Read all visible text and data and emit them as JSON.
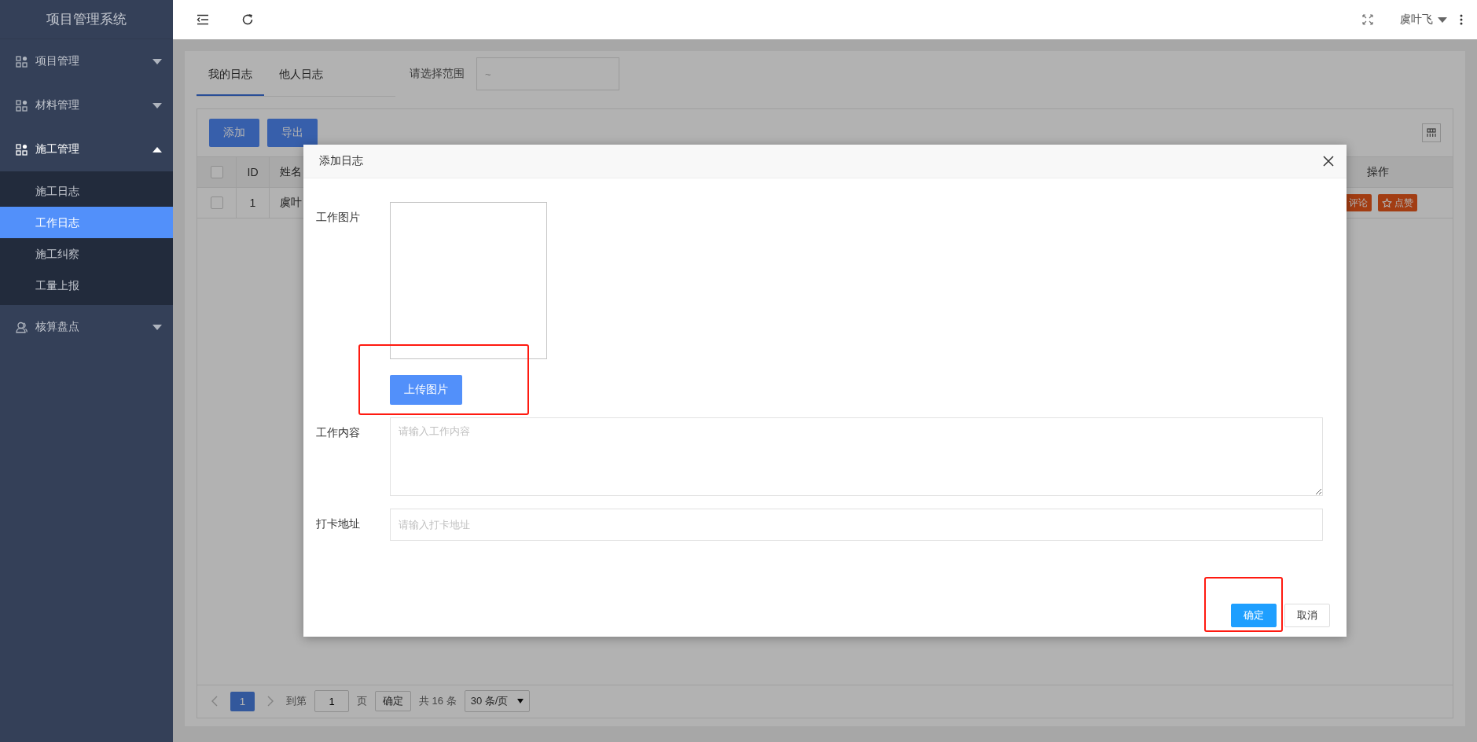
{
  "sidebar": {
    "title": "项目管理系统",
    "items": [
      {
        "label": "项目管理",
        "expanded": false
      },
      {
        "label": "材料管理",
        "expanded": false
      },
      {
        "label": "施工管理",
        "expanded": true,
        "children": [
          {
            "label": "施工日志",
            "selected": false
          },
          {
            "label": "工作日志",
            "selected": true
          },
          {
            "label": "施工纠察",
            "selected": false
          },
          {
            "label": "工量上报",
            "selected": false
          }
        ]
      },
      {
        "label": "核算盘点",
        "expanded": false
      }
    ]
  },
  "header": {
    "user": "虞叶飞"
  },
  "tabs": [
    {
      "label": "我的日志",
      "selected": true
    },
    {
      "label": "他人日志",
      "selected": false
    }
  ],
  "range": {
    "label": "请选择范围",
    "separator": "~"
  },
  "toolbar": {
    "buttons": [
      "添加",
      "导出"
    ]
  },
  "table": {
    "header_checked": false,
    "columns": [
      "ID",
      "姓名",
      "操作"
    ],
    "rows": [
      {
        "checked": false,
        "id": "1",
        "name": "虞叶",
        "actions": [
          "评论",
          "点赞"
        ]
      }
    ]
  },
  "pagination": {
    "pages": [
      {
        "label": "1",
        "selected": true
      }
    ],
    "goto_label": "到第",
    "goto_value": "1",
    "page_unit": "页",
    "confirm": "确定",
    "total": "共 16 条",
    "page_size": "30 条/页"
  },
  "dialog": {
    "title": "添加日志",
    "fields": [
      {
        "kind": "image",
        "label": "工作图片",
        "button": "上传图片",
        "highlighted": true
      },
      {
        "kind": "textarea",
        "label": "工作内容",
        "placeholder": "请输入工作内容",
        "highlighted": false
      },
      {
        "kind": "input",
        "label": "打卡地址",
        "placeholder": "请输入打卡地址",
        "highlighted": false
      }
    ],
    "buttons": [
      {
        "label": "确定",
        "primary": true,
        "highlighted": true
      },
      {
        "label": "取消",
        "primary": false,
        "highlighted": false
      }
    ]
  }
}
